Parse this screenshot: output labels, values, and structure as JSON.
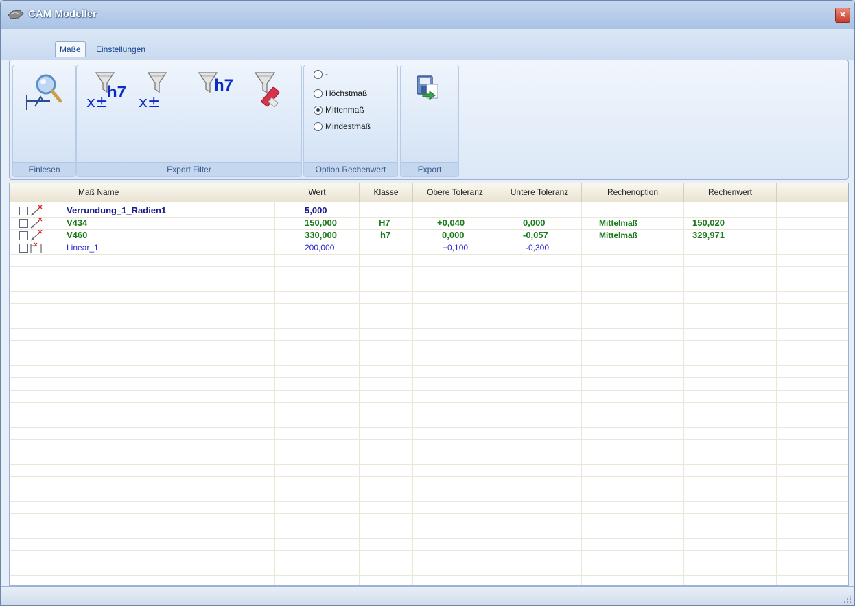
{
  "window": {
    "title": "CAM Modeller",
    "close_label": "×"
  },
  "tabs": [
    {
      "label": "Maße"
    },
    {
      "label": "Einstellungen"
    }
  ],
  "ribbon": {
    "groups": {
      "einlesen": "Einlesen",
      "export_filter": "Export Filter",
      "option": "Option Rechenwert",
      "export": "Export"
    },
    "filter_tokens": {
      "xpm": "x±",
      "h7": "h7"
    },
    "radio_options": [
      {
        "label": "-",
        "checked": false
      },
      {
        "label": "Höchstmaß",
        "checked": false
      },
      {
        "label": "Mittenmaß",
        "checked": true
      },
      {
        "label": "Mindestmaß",
        "checked": false
      }
    ]
  },
  "grid": {
    "columns": [
      "Maß Name",
      "Wert",
      "Klasse",
      "Obere Toleranz",
      "Untere Toleranz",
      "Rechenoption",
      "Rechenwert"
    ],
    "rows": [
      {
        "name": "Verrundung_1_Radien1",
        "wert": "5,000",
        "klasse": "",
        "obere": "",
        "untere": "",
        "option": "",
        "rechenwert": "",
        "color": "#1a1a8c",
        "bold": true,
        "icon": "radius-dimension-icon"
      },
      {
        "name": "V434",
        "wert": "150,000",
        "klasse": "H7",
        "obere": "+0,040",
        "untere": "0,000",
        "option": "Mittelmaß",
        "rechenwert": "150,020",
        "color": "#1a7a1a",
        "bold": true,
        "icon": "radius-dimension-icon"
      },
      {
        "name": "V460",
        "wert": "330,000",
        "klasse": "h7",
        "obere": "0,000",
        "untere": "-0,057",
        "option": "Mittelmaß",
        "rechenwert": "329,971",
        "color": "#1a7a1a",
        "bold": true,
        "icon": "radius-dimension-icon"
      },
      {
        "name": "Linear_1",
        "wert": "200,000",
        "klasse": "",
        "obere": "+0,100",
        "untere": "-0,300",
        "option": "",
        "rechenwert": "",
        "color": "#2a2ad0",
        "bold": false,
        "icon": "linear-dimension-icon"
      }
    ]
  }
}
